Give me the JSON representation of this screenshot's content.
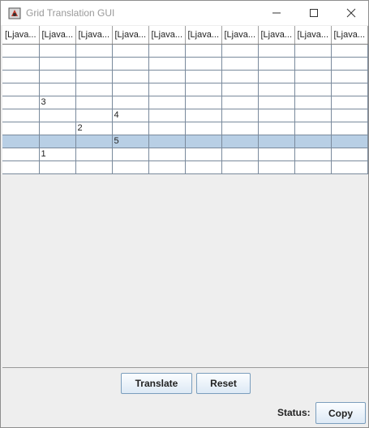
{
  "window": {
    "title": "Grid Translation GUI"
  },
  "table": {
    "headers": [
      "[Ljava...",
      "[Ljava...",
      "[Ljava...",
      "[Ljava...",
      "[Ljava...",
      "[Ljava...",
      "[Ljava...",
      "[Ljava...",
      "[Ljava...",
      "[Ljava..."
    ],
    "rows": [
      [
        "",
        "",
        "",
        "",
        "",
        "",
        "",
        "",
        "",
        ""
      ],
      [
        "",
        "",
        "",
        "",
        "",
        "",
        "",
        "",
        "",
        ""
      ],
      [
        "",
        "",
        "",
        "",
        "",
        "",
        "",
        "",
        "",
        ""
      ],
      [
        "",
        "",
        "",
        "",
        "",
        "",
        "",
        "",
        "",
        ""
      ],
      [
        "",
        "3",
        "",
        "",
        "",
        "",
        "",
        "",
        "",
        ""
      ],
      [
        "",
        "",
        "",
        "4",
        "",
        "",
        "",
        "",
        "",
        ""
      ],
      [
        "",
        "",
        "2",
        "",
        "",
        "",
        "",
        "",
        "",
        ""
      ],
      [
        "",
        "",
        "",
        "5",
        "",
        "",
        "",
        "",
        "",
        ""
      ],
      [
        "",
        "1",
        "",
        "",
        "",
        "",
        "",
        "",
        "",
        ""
      ],
      [
        "",
        "",
        "",
        "",
        "",
        "",
        "",
        "",
        "",
        ""
      ]
    ],
    "selected_row": 7
  },
  "buttons": {
    "translate": "Translate",
    "reset": "Reset",
    "copy": "Copy"
  },
  "status": {
    "label": "Status:"
  }
}
